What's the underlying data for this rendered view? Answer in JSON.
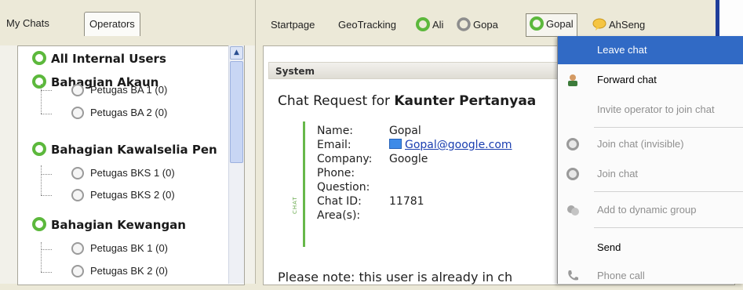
{
  "left_tabs": {
    "my_chats": "My Chats",
    "operators": "Operators"
  },
  "tree": {
    "groups": [
      {
        "label": "All Internal Users"
      },
      {
        "label": "Bahagian Akaun"
      },
      {
        "label": "Bahagian Kawalselia Pen"
      },
      {
        "label": "Bahagian Kewangan"
      }
    ],
    "leaves": [
      "Petugas BA 1 (0)",
      "Petugas BA 2 (0)",
      "Petugas BKS 1 (0)",
      "Petugas BKS 2 (0)",
      "Petugas BK 1 (0)",
      "Petugas BK 2 (0)"
    ]
  },
  "right_tabs": {
    "startpage": "Startpage",
    "geotracking": "GeoTracking",
    "ali": "Ali",
    "gopa": "Gopa",
    "gopal": "Gopal",
    "ahseng": "AhSeng"
  },
  "panel": {
    "system_label": "System",
    "request_prefix": "Chat Request for",
    "request_target": "Kaunter Pertanyaa",
    "vertical_label": "CHAT",
    "fields": [
      {
        "label": "Name:",
        "value": "Gopal"
      },
      {
        "label": "Email:",
        "value": "Gopal@google.com"
      },
      {
        "label": "Company:",
        "value": "Google"
      },
      {
        "label": "Phone:",
        "value": ""
      },
      {
        "label": "Question:",
        "value": ""
      },
      {
        "label": "Chat ID:",
        "value": "11781"
      },
      {
        "label": "Area(s):",
        "value": ""
      }
    ],
    "note": "Please note: this user is already in ch"
  },
  "context_menu": {
    "items": [
      {
        "label": "Leave chat",
        "icon": "none",
        "state": "highlighted"
      },
      {
        "label": "Forward chat",
        "icon": "operator-icon",
        "state": "enabled"
      },
      {
        "label": "Invite operator to join chat",
        "icon": "none",
        "state": "disabled"
      },
      {
        "label": "Join chat (invisible)",
        "icon": "gray-circle-icon",
        "state": "disabled"
      },
      {
        "label": "Join chat",
        "icon": "gray-circle-icon",
        "state": "disabled"
      },
      {
        "label": "Add to dynamic group",
        "icon": "group-icon",
        "state": "disabled"
      },
      {
        "label": "Send",
        "icon": "none",
        "state": "enabled"
      },
      {
        "label": "Phone call",
        "icon": "phone-icon",
        "state": "disabled"
      }
    ]
  },
  "colors": {
    "highlight": "#316ac5",
    "status_green": "#5cb83c",
    "chat_bar": "#67b84a"
  }
}
